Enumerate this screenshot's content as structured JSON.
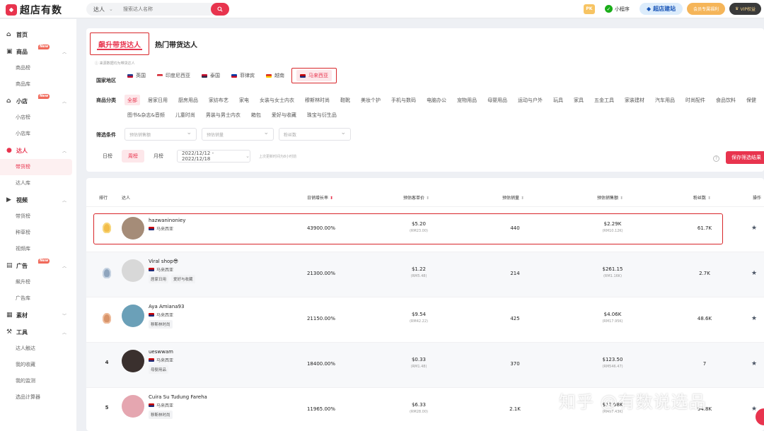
{
  "app": {
    "logo_text": "超店有数",
    "search_type": "达人",
    "search_placeholder": "搜索达人名称",
    "pk": "PK",
    "mini_program": "小程序",
    "site_btn": "超店建站",
    "member_btn": "会员专属福利",
    "vip_btn": "VIP权益"
  },
  "sidebar": {
    "groups": [
      {
        "label": "首页",
        "icon": "home-icon",
        "items": []
      },
      {
        "label": "商品",
        "icon": "goods-icon",
        "badge": "New",
        "items": [
          "商品榜",
          "商品库"
        ]
      },
      {
        "label": "小店",
        "icon": "shop-icon",
        "badge": "New",
        "items": [
          "小店榜",
          "小店库"
        ]
      },
      {
        "label": "达人",
        "icon": "user-icon",
        "active": true,
        "items": [
          "带货榜",
          "达人库"
        ]
      },
      {
        "label": "视频",
        "icon": "video-icon",
        "items": [
          "带货榜",
          "种草榜",
          "视频库"
        ]
      },
      {
        "label": "广告",
        "icon": "ad-icon",
        "badge": "New",
        "items": [
          "飙升榜",
          "广告库"
        ]
      },
      {
        "label": "素材",
        "icon": "material-icon",
        "items": []
      },
      {
        "label": "工具",
        "icon": "tool-icon",
        "items": [
          "达人触达",
          "我的收藏",
          "我的监测",
          "选品计算器"
        ]
      }
    ]
  },
  "tabs": [
    "飙升带货达人",
    "热门带货达人"
  ],
  "note": "ⓘ 来源数据均为带货达人",
  "labels": {
    "country": "国家地区",
    "category": "商品分类",
    "filter": "筛选条件"
  },
  "countries": [
    {
      "name": "英国",
      "flag": "gb"
    },
    {
      "name": "印度尼西亚",
      "flag": "id"
    },
    {
      "name": "泰国",
      "flag": "th"
    },
    {
      "name": "菲律宾",
      "flag": "ph"
    },
    {
      "name": "越南",
      "flag": "vn"
    },
    {
      "name": "马来西亚",
      "flag": "my",
      "active": true
    }
  ],
  "categories": [
    "全部",
    "居家日用",
    "厨房用品",
    "家纺布艺",
    "家电",
    "女装与女士内衣",
    "穆斯林时尚",
    "鞋靴",
    "美妆个护",
    "手机与数码",
    "电脑办公",
    "宠物用品",
    "母婴用品",
    "运动与户外",
    "玩具",
    "家具",
    "五金工具",
    "家装建材",
    "汽车用品",
    "时尚配件",
    "食品饮料",
    "保健",
    "图书&杂志&音频",
    "儿童时尚",
    "男装与男士内衣",
    "箱包",
    "爱好与收藏",
    "珠宝与衍生品"
  ],
  "filters": [
    "预估销售额",
    "预估销量",
    "粉丝数"
  ],
  "periods": [
    "日榜",
    "周榜",
    "月榜"
  ],
  "date_range": "2022/12/12 - 2022/12/18",
  "update_note": "上次更新时间为8小时前",
  "save_btn": "保存筛选结果",
  "table": {
    "headers": {
      "rank": "排行",
      "creator": "达人",
      "growth": "日销增长率",
      "price": "预估客单价",
      "sales": "预估销量",
      "revenue": "预估销售额",
      "fans": "粉丝数",
      "op": "操作"
    },
    "rows": [
      {
        "rank": "1",
        "medal": "gold",
        "name": "hazwaninoniey",
        "country": "马来西亚",
        "tags": [],
        "growth": "43900.00%",
        "price": "$5.20",
        "price_local": "(RM23.00)",
        "sales": "440",
        "revenue": "$2.29K",
        "revenue_local": "(RM10.12K)",
        "fans": "61.7K",
        "avatar": "#a58c78"
      },
      {
        "rank": "2",
        "medal": "silver",
        "name": "Viral shop😎",
        "country": "马来西亚",
        "tags": [
          "居家日用",
          "爱好与收藏"
        ],
        "growth": "21300.00%",
        "price": "$1.22",
        "price_local": "(RM5.48)",
        "sales": "214",
        "revenue": "$261.15",
        "revenue_local": "(RM1.16K)",
        "fans": "2.7K",
        "avatar": "#d8d8d8"
      },
      {
        "rank": "3",
        "medal": "bronze",
        "name": "Aya Amiana93",
        "country": "马来西亚",
        "tags": [
          "穆斯林时尚"
        ],
        "growth": "21150.00%",
        "price": "$9.54",
        "price_local": "(RM42.22)",
        "sales": "425",
        "revenue": "$4.06K",
        "revenue_local": "(RM17.95K)",
        "fans": "48.6K",
        "avatar": "#6ba0b8"
      },
      {
        "rank": "4",
        "medal": "",
        "name": "ueswwam",
        "country": "马来西亚",
        "tags": [
          "母婴用品"
        ],
        "growth": "18400.00%",
        "price": "$0.33",
        "price_local": "(RM1.48)",
        "sales": "370",
        "revenue": "$123.50",
        "revenue_local": "(RM546.47)",
        "fans": "7",
        "avatar": "#3a302e"
      },
      {
        "rank": "5",
        "medal": "",
        "name": "Cuira Su Tudung Fareha",
        "country": "马来西亚",
        "tags": [
          "穆斯林时尚"
        ],
        "growth": "11965.00%",
        "price": "$6.33",
        "price_local": "(RM28.00)",
        "sales": "2.1K",
        "revenue": "$12.98K",
        "revenue_local": "(RM57.43K)",
        "fans": "94.8K",
        "avatar": "#e5a6b0"
      }
    ]
  },
  "watermark": "知乎 @有数说选品",
  "colors": {
    "accent": "#e8344e",
    "highlight_box": "#d8262a"
  }
}
